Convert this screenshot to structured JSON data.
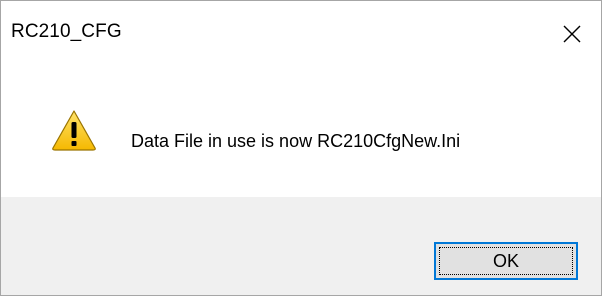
{
  "window": {
    "title": "RC210_CFG",
    "close_icon": "close-icon"
  },
  "message": {
    "icon": "warning-icon",
    "text": "Data File in use is now RC210CfgNew.Ini"
  },
  "buttons": {
    "ok_label": "OK"
  },
  "colors": {
    "warning_yellow": "#f8c81c",
    "warning_border": "#b8860b",
    "focus_border": "#0078d7",
    "footer_bg": "#f0f0f0"
  }
}
